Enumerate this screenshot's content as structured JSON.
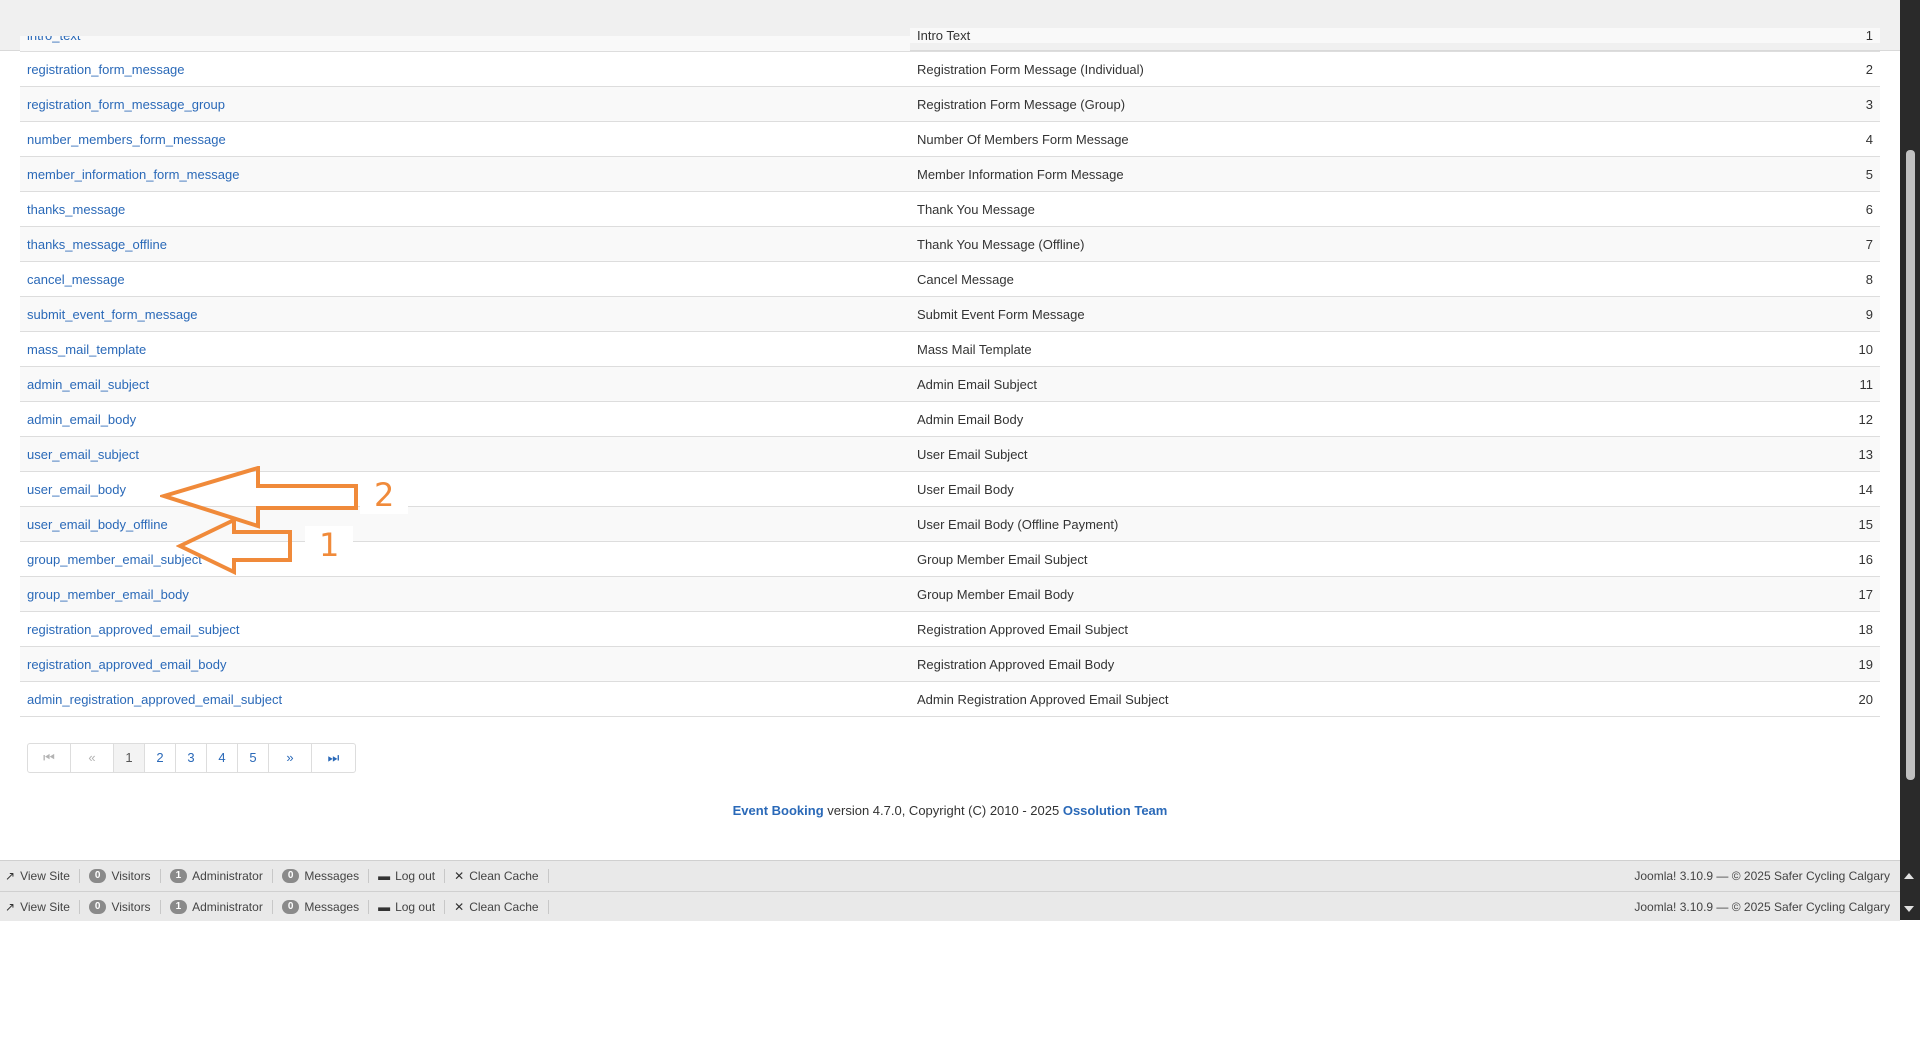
{
  "table": {
    "partial_row": {
      "key": "intro_text",
      "title": "Intro Text",
      "num": "1"
    },
    "rows": [
      {
        "key": "registration_form_message",
        "title": "Registration Form Message (Individual)",
        "num": "2"
      },
      {
        "key": "registration_form_message_group",
        "title": "Registration Form Message (Group)",
        "num": "3"
      },
      {
        "key": "number_members_form_message",
        "title": "Number Of Members Form Message",
        "num": "4"
      },
      {
        "key": "member_information_form_message",
        "title": "Member Information Form Message",
        "num": "5"
      },
      {
        "key": "thanks_message",
        "title": "Thank You Message",
        "num": "6"
      },
      {
        "key": "thanks_message_offline",
        "title": "Thank You Message (Offline)",
        "num": "7"
      },
      {
        "key": "cancel_message",
        "title": "Cancel Message",
        "num": "8"
      },
      {
        "key": "submit_event_form_message",
        "title": "Submit Event Form Message",
        "num": "9"
      },
      {
        "key": "mass_mail_template",
        "title": "Mass Mail Template",
        "num": "10"
      },
      {
        "key": "admin_email_subject",
        "title": "Admin Email Subject",
        "num": "11"
      },
      {
        "key": "admin_email_body",
        "title": "Admin Email Body",
        "num": "12"
      },
      {
        "key": "user_email_subject",
        "title": "User Email Subject",
        "num": "13"
      },
      {
        "key": "user_email_body",
        "title": "User Email Body",
        "num": "14"
      },
      {
        "key": "user_email_body_offline",
        "title": "User Email Body (Offline Payment)",
        "num": "15"
      },
      {
        "key": "group_member_email_subject",
        "title": "Group Member Email Subject",
        "num": "16"
      },
      {
        "key": "group_member_email_body",
        "title": "Group Member Email Body",
        "num": "17"
      },
      {
        "key": "registration_approved_email_subject",
        "title": "Registration Approved Email Subject",
        "num": "18"
      },
      {
        "key": "registration_approved_email_body",
        "title": "Registration Approved Email Body",
        "num": "19"
      },
      {
        "key": "admin_registration_approved_email_subject",
        "title": "Admin Registration Approved Email Subject",
        "num": "20"
      }
    ]
  },
  "pagination": {
    "first_icon": "⏮",
    "prev_icon": "«",
    "pages": [
      "1",
      "2",
      "3",
      "4",
      "5"
    ],
    "active_page": "1",
    "next_icon": "»",
    "last_icon": "⏭"
  },
  "footer": {
    "product": "Event Booking",
    "middle": " version 4.7.0, Copyright (C) 2010 - 2025 ",
    "team": "Ossolution Team"
  },
  "statusbar": {
    "view_site": "View Site",
    "visitors_count": "0",
    "visitors_label": "Visitors",
    "admin_count": "1",
    "admin_label": "Administrator",
    "messages_count": "0",
    "messages_label": "Messages",
    "logout": "Log out",
    "clean_cache": "Clean Cache",
    "right_text": "Joomla! 3.10.9  —  © 2025 Safer Cycling Calgary"
  },
  "annotations": {
    "arrow_1_label": "1",
    "arrow_2_label": "2",
    "color": "#f08a3a"
  },
  "colors": {
    "link": "#2a69b8",
    "badge": "#8a8a8a"
  }
}
